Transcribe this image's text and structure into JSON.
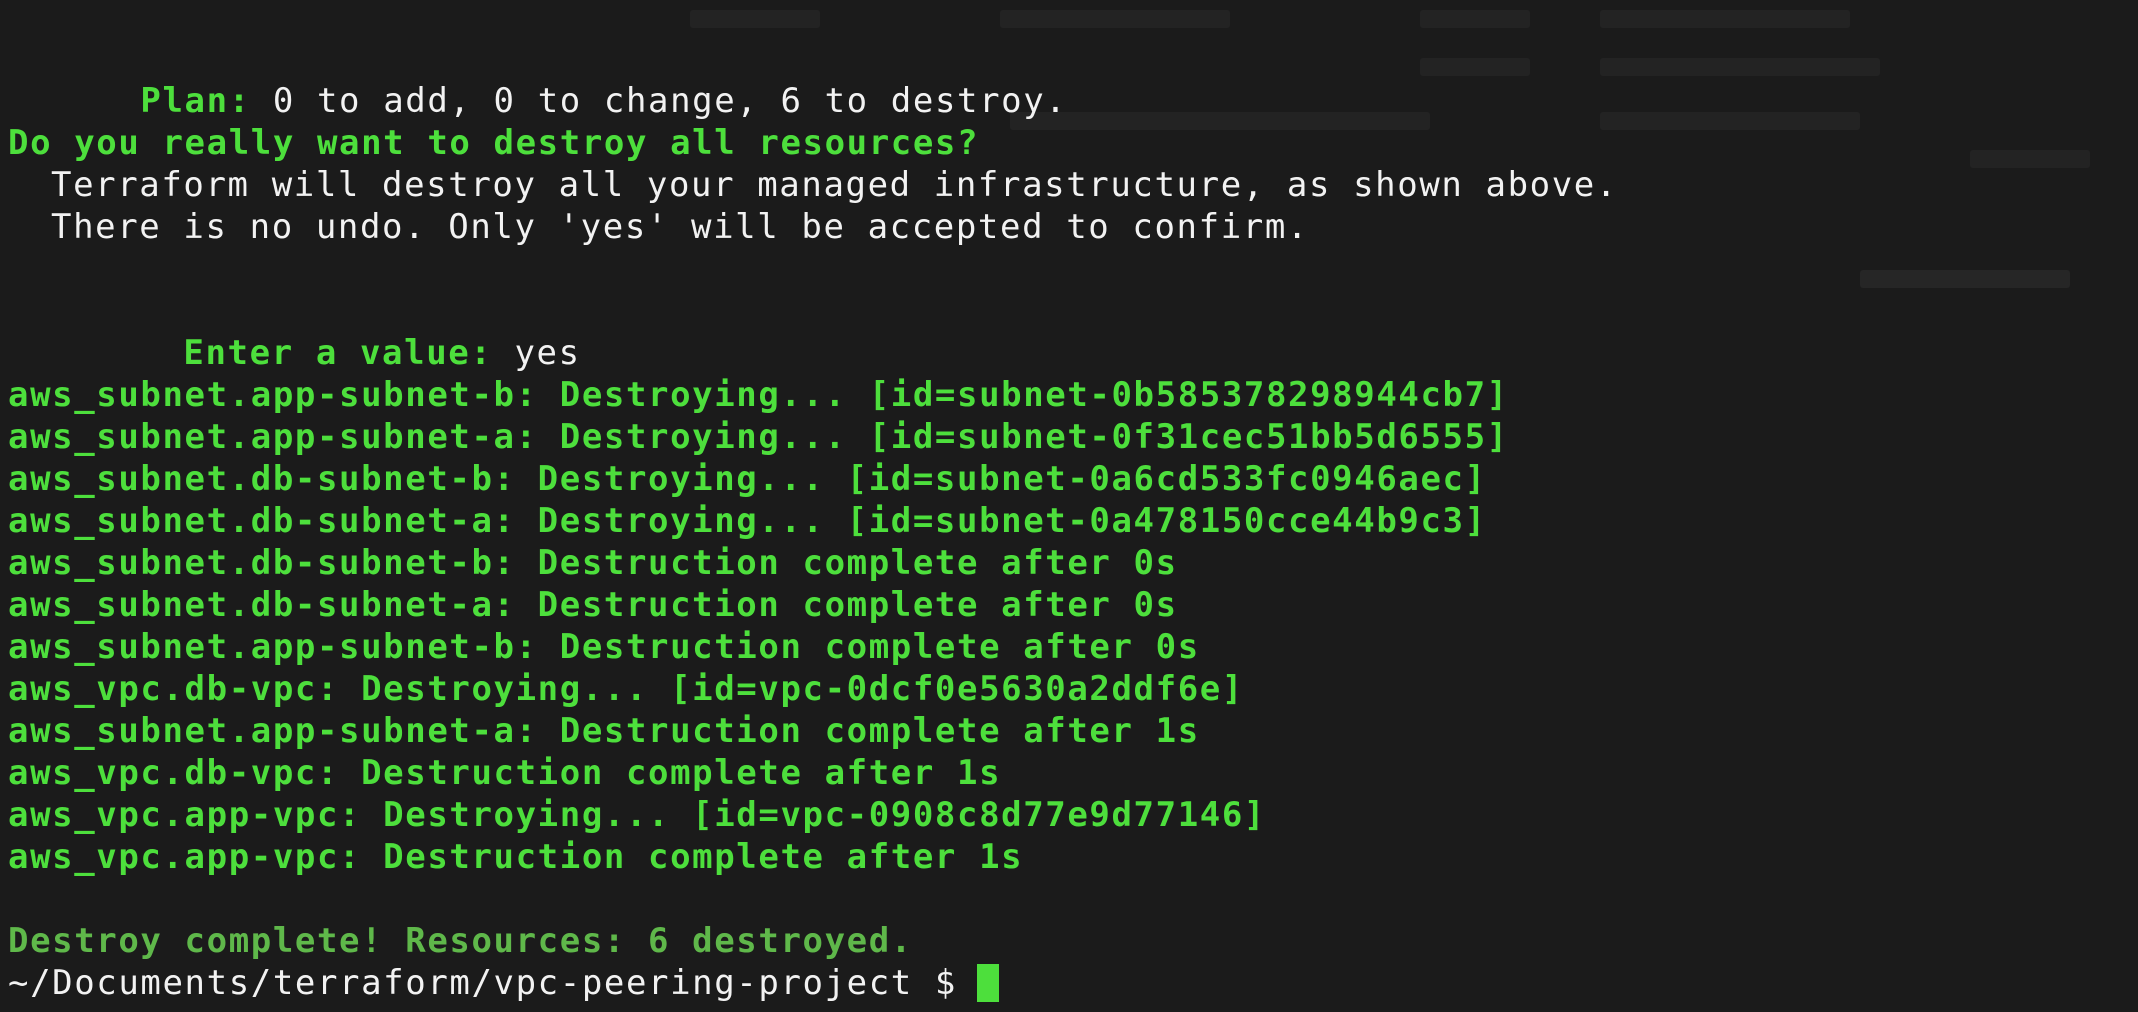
{
  "terminal": {
    "plan_label": "Plan:",
    "plan_text": " 0 to add, 0 to change, 6 to destroy.",
    "question": "Do you really want to destroy all resources?",
    "warning_1": "Terraform will destroy all your managed infrastructure, as shown above.",
    "warning_2": "There is no undo. Only 'yes' will be accepted to confirm.",
    "enter_label": "Enter a value:",
    "enter_value": " yes",
    "log_lines": [
      "aws_subnet.app-subnet-b: Destroying... [id=subnet-0b585378298944cb7]",
      "aws_subnet.app-subnet-a: Destroying... [id=subnet-0f31cec51bb5d6555]",
      "aws_subnet.db-subnet-b: Destroying... [id=subnet-0a6cd533fc0946aec]",
      "aws_subnet.db-subnet-a: Destroying... [id=subnet-0a478150cce44b9c3]",
      "aws_subnet.db-subnet-b: Destruction complete after 0s",
      "aws_subnet.db-subnet-a: Destruction complete after 0s",
      "aws_subnet.app-subnet-b: Destruction complete after 0s",
      "aws_vpc.db-vpc: Destroying... [id=vpc-0dcf0e5630a2ddf6e]",
      "aws_subnet.app-subnet-a: Destruction complete after 1s",
      "aws_vpc.db-vpc: Destruction complete after 1s",
      "aws_vpc.app-vpc: Destroying... [id=vpc-0908c8d77e9d77146]",
      "aws_vpc.app-vpc: Destruction complete after 1s"
    ],
    "summary": "Destroy complete! Resources: 6 destroyed.",
    "prompt": "~/Documents/terraform/vpc-peering-project $"
  },
  "colors": {
    "background": "#1b1b1b",
    "green": "#4ddf3c",
    "summary_green": "#5fb84a",
    "text": "#f2f2f2",
    "cursor": "#4ddf3c"
  }
}
